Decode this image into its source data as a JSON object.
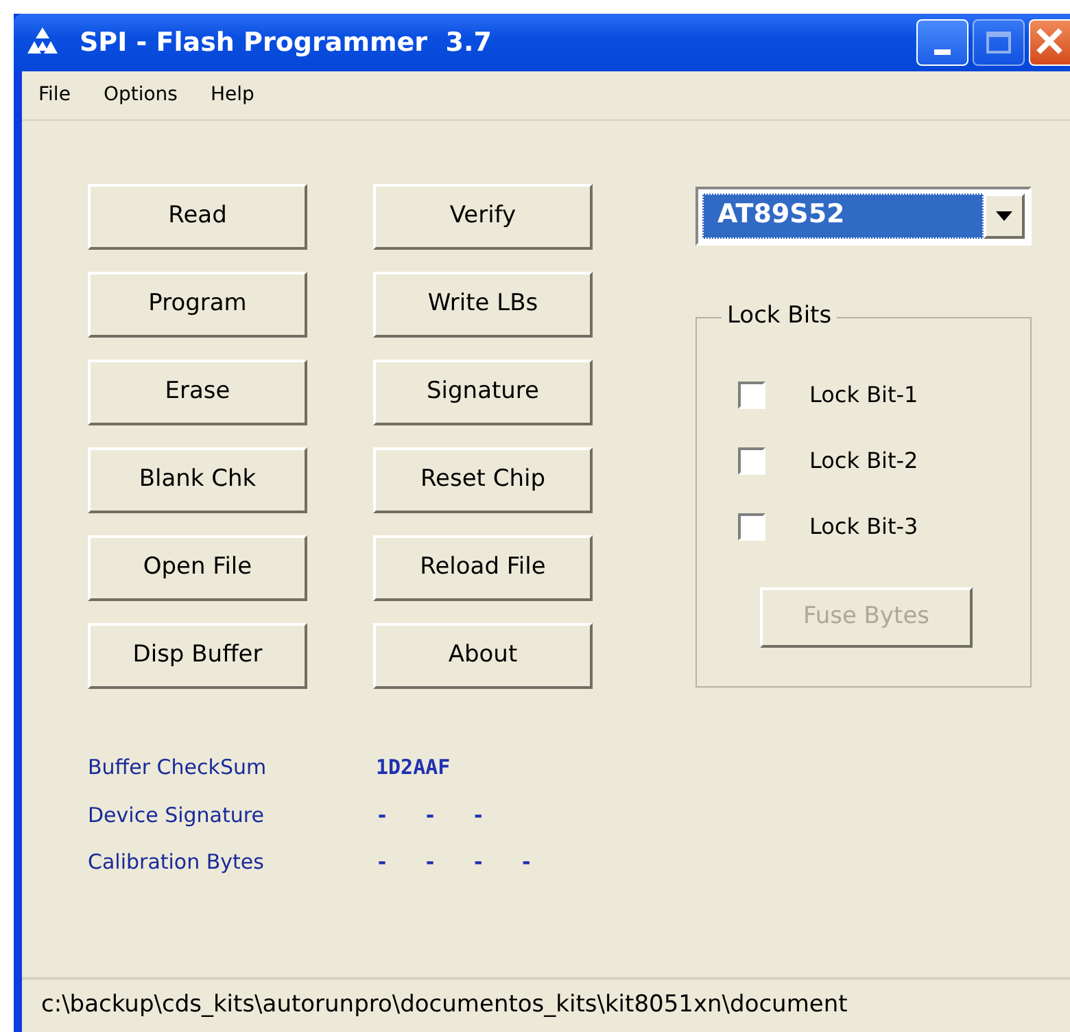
{
  "window": {
    "title": "SPI - Flash Programmer  3.7"
  },
  "menu": [
    "File",
    "Options",
    "Help"
  ],
  "buttons": [
    {
      "label": "Read"
    },
    {
      "label": "Verify"
    },
    {
      "label": "Program"
    },
    {
      "label": "Write LBs"
    },
    {
      "label": "Erase"
    },
    {
      "label": "Signature"
    },
    {
      "label": "Blank Chk"
    },
    {
      "label": "Reset Chip"
    },
    {
      "label": "Open File"
    },
    {
      "label": "Reload File"
    },
    {
      "label": "Disp Buffer"
    },
    {
      "label": "About"
    }
  ],
  "device": {
    "value": "AT89S52"
  },
  "lock_bits": {
    "title": "Lock Bits",
    "items": [
      {
        "label": "Lock Bit-1",
        "checked": false
      },
      {
        "label": "Lock Bit-2",
        "checked": false
      },
      {
        "label": "Lock Bit-3",
        "checked": false
      }
    ],
    "button": {
      "label": "Fuse Bytes",
      "disabled": true
    }
  },
  "info": [
    {
      "label": "Buffer CheckSum",
      "values": [
        "1D2AAF"
      ]
    },
    {
      "label": "Device Signature",
      "values": [
        "-",
        "-",
        "-"
      ]
    },
    {
      "label": "Calibration Bytes",
      "values": [
        "-",
        "-",
        "-",
        "-"
      ]
    }
  ],
  "status_bar": "c:\\backup\\cds_kits\\autorunpro\\documentos_kits\\kit8051xn\\document"
}
